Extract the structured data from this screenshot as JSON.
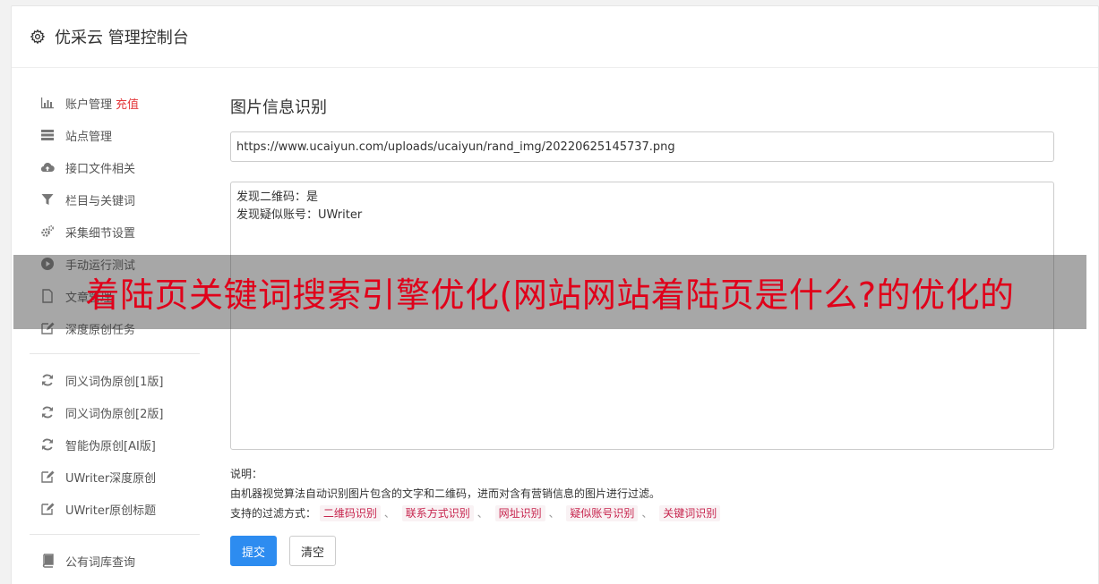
{
  "header": {
    "title": "优采云 管理控制台",
    "icon": "gear-icon"
  },
  "sidebar": {
    "group1": [
      {
        "label": "账户管理",
        "extra": "充值",
        "icon": "bar-chart-icon"
      },
      {
        "label": "站点管理",
        "icon": "server-icon"
      },
      {
        "label": "接口文件相关",
        "icon": "cloud-upload-icon"
      },
      {
        "label": "栏目与关键词",
        "icon": "filter-icon"
      },
      {
        "label": "采集细节设置",
        "icon": "cogs-icon"
      },
      {
        "label": "手动运行测试",
        "icon": "play-circle-icon"
      },
      {
        "label": "文章管理",
        "icon": "file-icon"
      },
      {
        "label": "深度原创任务",
        "icon": "edit-icon"
      }
    ],
    "group2": [
      {
        "label": "同义词伪原创[1版]",
        "icon": "refresh-icon"
      },
      {
        "label": "同义词伪原创[2版]",
        "icon": "refresh-icon"
      },
      {
        "label": "智能伪原创[AI版]",
        "icon": "refresh-icon"
      },
      {
        "label": "UWriter深度原创",
        "icon": "edit-icon"
      },
      {
        "label": "UWriter原创标题",
        "icon": "edit-icon"
      }
    ],
    "group3": [
      {
        "label": "公有词库查询",
        "icon": "book-icon"
      }
    ]
  },
  "main": {
    "title": "图片信息识别",
    "url_value": "https://www.ucaiyun.com/uploads/ucaiyun/rand_img/20220625145737.png",
    "result_text": "发现二维码：是\n发现疑似账号：UWriter",
    "note_label": "说明：",
    "note_desc": "由机器视觉算法自动识别图片包含的文字和二维码，进而对含有营销信息的图片进行过滤。",
    "filter_label": "支持的过滤方式：",
    "filters": [
      "二维码识别",
      "联系方式识别",
      "网址识别",
      "疑似账号识别",
      "关键词识别"
    ],
    "separator": "、",
    "submit_label": "提交",
    "clear_label": "清空"
  },
  "banner": {
    "text": "着陆页关键词搜索引擎优化(网站网站着陆页是什么?的优化的"
  },
  "colors": {
    "primary": "#2d8cf0",
    "recharge": "#e4393c",
    "banner_text": "#e0001a",
    "tag_text": "#c7254e"
  }
}
